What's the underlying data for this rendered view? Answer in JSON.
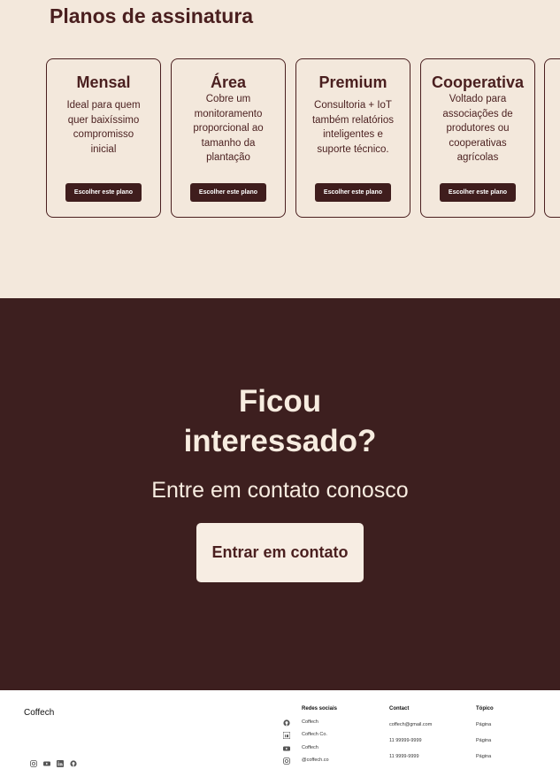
{
  "plans": {
    "title": "Planos de assinatura",
    "cards": [
      {
        "title": "Mensal",
        "description": "Ideal para quem quer baixíssimo compromisso inicial",
        "button": "Escolher este plano"
      },
      {
        "title": "Área",
        "description": "Cobre um monitoramento proporcional ao tamanho da plantação",
        "button": "Escolher este plano"
      },
      {
        "title": "Premium",
        "description": "Consultoria + IoT também relatórios inteligentes e suporte técnico.",
        "button": "Escolher este plano"
      },
      {
        "title": "Cooperativa",
        "description": "Voltado para associações de produtores ou cooperativas agrícolas",
        "button": "Escolher este plano"
      }
    ]
  },
  "cta": {
    "heading_line1": "Ficou",
    "heading_line2": "interessado?",
    "subheading": "Entre em contato conosco",
    "button": "Entrar em contato"
  },
  "footer": {
    "brand": "Coffech",
    "social_icons": [
      "instagram-icon",
      "youtube-icon",
      "linkedin-icon",
      "github-icon"
    ],
    "redes": {
      "heading": "Redes sociais",
      "items": [
        {
          "icon": "github-icon",
          "label": "Coffech"
        },
        {
          "icon": "linkedin-icon",
          "label": "Coffech Co."
        },
        {
          "icon": "youtube-icon",
          "label": "Coffech"
        },
        {
          "icon": "instagram-icon",
          "label": "@coffech.co"
        }
      ]
    },
    "contact": {
      "heading": "Contact",
      "items": [
        "coffech@gmail.com",
        "11 99999-9999",
        "11 9999-9999"
      ]
    },
    "topico": {
      "heading": "Tópico",
      "items": [
        "Página",
        "Página",
        "Página"
      ]
    }
  },
  "colors": {
    "cream": "#f3e8dc",
    "brown_dark": "#3d1f1f",
    "brown_text": "#4a1f1f",
    "button_cream": "#f7ede3"
  }
}
